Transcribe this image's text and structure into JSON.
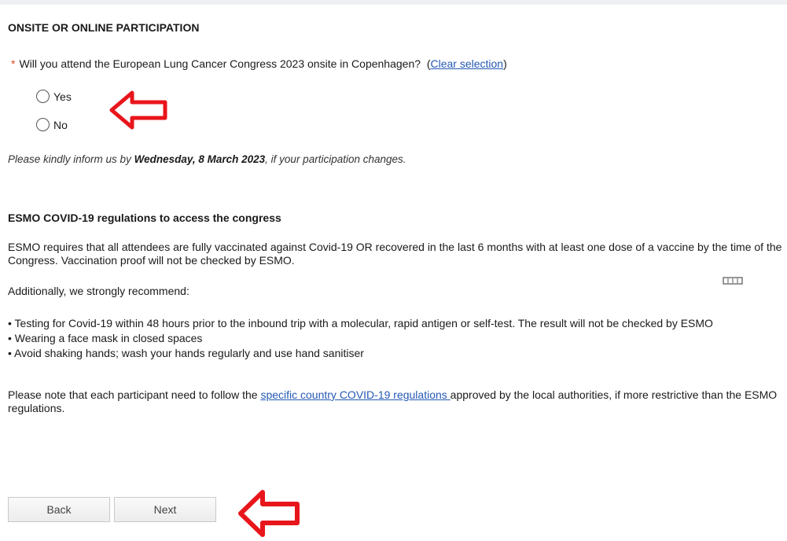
{
  "section": {
    "title": "ONSITE OR ONLINE PARTICIPATION",
    "question": {
      "required_marker": "*",
      "text": "Will you attend the European Lung Cancer Congress 2023 onsite in Copenhagen?",
      "clear_prefix": "(",
      "clear_label": "Clear selection",
      "clear_suffix": ")"
    },
    "options": [
      {
        "label": "Yes",
        "selected": false
      },
      {
        "label": "No",
        "selected": false
      }
    ],
    "note": {
      "prefix": "Please kindly inform us by ",
      "date": "Wednesday, 8 March 2023",
      "suffix": ", if your participation changes."
    }
  },
  "covid": {
    "title": "ESMO COVID-19 regulations to access the congress",
    "para1": "ESMO requires that all attendees are fully vaccinated against Covid-19 OR recovered in the last 6 months with at least one dose of a vaccine by the time of the Congress. Vaccination proof will not be checked by ESMO.",
    "para2": "Additionally, we strongly recommend:",
    "bullets": [
      "• Testing for Covid-19 within 48 hours prior to the inbound trip with a molecular, rapid antigen or self-test. The result will not be checked by ESMO",
      "• Wearing a face mask in closed spaces",
      "• Avoid shaking hands; wash your hands regularly and use hand sanitiser"
    ],
    "para3_prefix": "Please note that each participant need to follow the ",
    "para3_link": "specific country COVID-19 regulations ",
    "para3_suffix": "approved by the local authorities, if more restrictive than the ESMO regulations."
  },
  "buttons": {
    "back": "Back",
    "next": "Next"
  },
  "colors": {
    "link": "#2458b3",
    "required": "#e0452f",
    "annotation_arrow": "#e8151b"
  },
  "icons": {
    "annotation": "left-arrow-icon",
    "small": "keyboard-icon"
  }
}
